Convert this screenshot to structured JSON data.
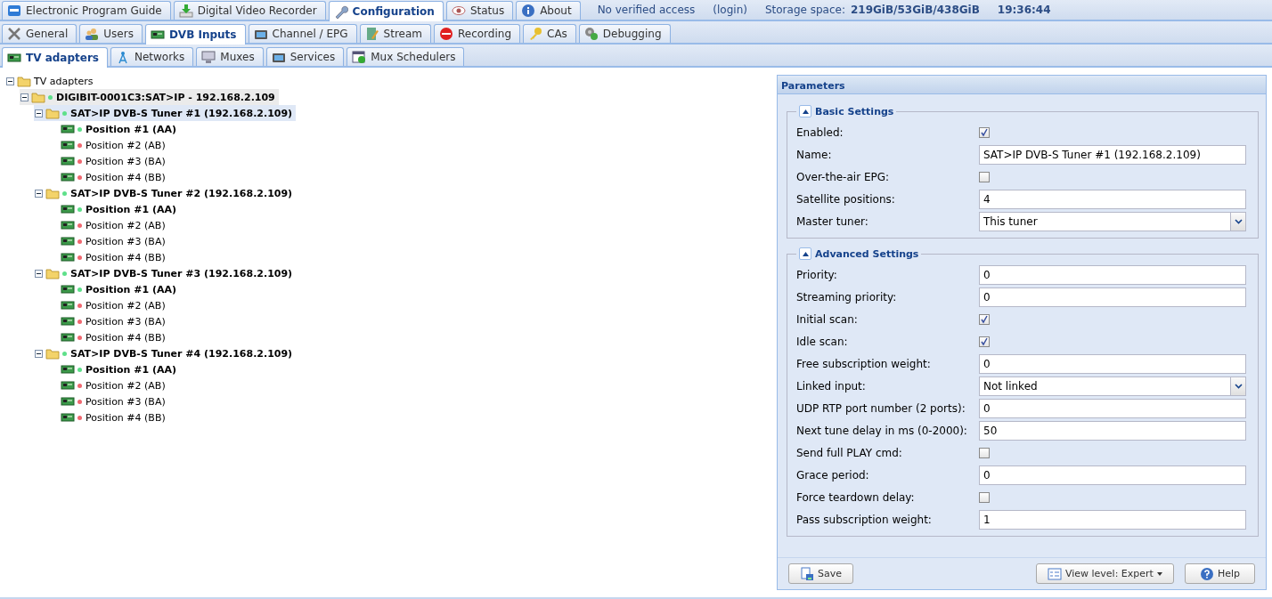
{
  "top_tabs": [
    {
      "label": "Electronic Program Guide",
      "selected": false
    },
    {
      "label": "Digital Video Recorder",
      "selected": false
    },
    {
      "label": "Configuration",
      "selected": true
    },
    {
      "label": "Status",
      "selected": false
    },
    {
      "label": "About",
      "selected": false
    }
  ],
  "status": {
    "access": "No verified access",
    "login": "(login)",
    "storage_label": "Storage space:",
    "storage_value": "219GiB/53GiB/438GiB",
    "time": "19:36:44"
  },
  "config_tabs": [
    {
      "label": "General",
      "selected": false
    },
    {
      "label": "Users",
      "selected": false
    },
    {
      "label": "DVB Inputs",
      "selected": true
    },
    {
      "label": "Channel / EPG",
      "selected": false
    },
    {
      "label": "Stream",
      "selected": false
    },
    {
      "label": "Recording",
      "selected": false
    },
    {
      "label": "CAs",
      "selected": false
    },
    {
      "label": "Debugging",
      "selected": false
    }
  ],
  "dvb_tabs": [
    {
      "label": "TV adapters",
      "selected": true
    },
    {
      "label": "Networks",
      "selected": false
    },
    {
      "label": "Muxes",
      "selected": false
    },
    {
      "label": "Services",
      "selected": false
    },
    {
      "label": "Mux Schedulers",
      "selected": false
    }
  ],
  "tree": {
    "label": "TV adapters",
    "expanded": true,
    "children": [
      {
        "label": "DIGIBIT-0001C3:SAT>IP - 192.168.2.109",
        "kind": "folder",
        "color": "#5ee08a",
        "enabled": true,
        "selected": false,
        "hovered": true,
        "expanded": true,
        "children": [
          {
            "label": "SAT>IP DVB-S Tuner #1 (192.168.2.109)",
            "kind": "folder",
            "color": "#5ee08a",
            "enabled": true,
            "selected": true,
            "hovered": false,
            "expanded": true,
            "children": [
              {
                "label": "Position #1 (AA)",
                "kind": "card",
                "color": "#5ee08a",
                "enabled": true,
                "selected": false,
                "hovered": false
              },
              {
                "label": "Position #2 (AB)",
                "kind": "card",
                "color": "#f06870",
                "enabled": false,
                "selected": false,
                "hovered": false
              },
              {
                "label": "Position #3 (BA)",
                "kind": "card",
                "color": "#f06870",
                "enabled": false,
                "selected": false,
                "hovered": false
              },
              {
                "label": "Position #4 (BB)",
                "kind": "card",
                "color": "#f06870",
                "enabled": false,
                "selected": false,
                "hovered": false
              }
            ]
          },
          {
            "label": "SAT>IP DVB-S Tuner #2 (192.168.2.109)",
            "kind": "folder",
            "color": "#5ee08a",
            "enabled": true,
            "selected": false,
            "hovered": false,
            "expanded": true,
            "children": [
              {
                "label": "Position #1 (AA)",
                "kind": "card",
                "color": "#5ee08a",
                "enabled": true,
                "selected": false,
                "hovered": false
              },
              {
                "label": "Position #2 (AB)",
                "kind": "card",
                "color": "#f06870",
                "enabled": false,
                "selected": false,
                "hovered": false
              },
              {
                "label": "Position #3 (BA)",
                "kind": "card",
                "color": "#f06870",
                "enabled": false,
                "selected": false,
                "hovered": false
              },
              {
                "label": "Position #4 (BB)",
                "kind": "card",
                "color": "#f06870",
                "enabled": false,
                "selected": false,
                "hovered": false
              }
            ]
          },
          {
            "label": "SAT>IP DVB-S Tuner #3 (192.168.2.109)",
            "kind": "folder",
            "color": "#5ee08a",
            "enabled": true,
            "selected": false,
            "hovered": false,
            "expanded": true,
            "children": [
              {
                "label": "Position #1 (AA)",
                "kind": "card",
                "color": "#5ee08a",
                "enabled": true,
                "selected": false,
                "hovered": false
              },
              {
                "label": "Position #2 (AB)",
                "kind": "card",
                "color": "#f06870",
                "enabled": false,
                "selected": false,
                "hovered": false
              },
              {
                "label": "Position #3 (BA)",
                "kind": "card",
                "color": "#f06870",
                "enabled": false,
                "selected": false,
                "hovered": false
              },
              {
                "label": "Position #4 (BB)",
                "kind": "card",
                "color": "#f06870",
                "enabled": false,
                "selected": false,
                "hovered": false
              }
            ]
          },
          {
            "label": "SAT>IP DVB-S Tuner #4 (192.168.2.109)",
            "kind": "folder",
            "color": "#5ee08a",
            "enabled": true,
            "selected": false,
            "hovered": false,
            "expanded": true,
            "children": [
              {
                "label": "Position #1 (AA)",
                "kind": "card",
                "color": "#5ee08a",
                "enabled": true,
                "selected": false,
                "hovered": false
              },
              {
                "label": "Position #2 (AB)",
                "kind": "card",
                "color": "#f06870",
                "enabled": false,
                "selected": false,
                "hovered": false
              },
              {
                "label": "Position #3 (BA)",
                "kind": "card",
                "color": "#f06870",
                "enabled": false,
                "selected": false,
                "hovered": false
              },
              {
                "label": "Position #4 (BB)",
                "kind": "card",
                "color": "#f06870",
                "enabled": false,
                "selected": false,
                "hovered": false
              }
            ]
          }
        ]
      }
    ]
  },
  "params": {
    "title": "Parameters",
    "sections": [
      {
        "title": "Basic Settings",
        "expanded": true,
        "fields": [
          {
            "kind": "checkbox",
            "label": "Enabled:",
            "checked": true
          },
          {
            "kind": "text",
            "label": "Name:",
            "value": "SAT>IP DVB-S Tuner #1 (192.168.2.109)"
          },
          {
            "kind": "checkbox",
            "label": "Over-the-air EPG:",
            "checked": false
          },
          {
            "kind": "text",
            "label": "Satellite positions:",
            "value": "4"
          },
          {
            "kind": "select",
            "label": "Master tuner:",
            "value": "This tuner"
          }
        ]
      },
      {
        "title": "Advanced Settings",
        "expanded": true,
        "fields": [
          {
            "kind": "text",
            "label": "Priority:",
            "value": "0"
          },
          {
            "kind": "text",
            "label": "Streaming priority:",
            "value": "0"
          },
          {
            "kind": "checkbox",
            "label": "Initial scan:",
            "checked": true
          },
          {
            "kind": "checkbox",
            "label": "Idle scan:",
            "checked": true
          },
          {
            "kind": "text",
            "label": "Free subscription weight:",
            "value": "0"
          },
          {
            "kind": "select",
            "label": "Linked input:",
            "value": "Not linked"
          },
          {
            "kind": "text",
            "label": "UDP RTP port number (2 ports):",
            "value": "0"
          },
          {
            "kind": "text",
            "label": "Next tune delay in ms (0-2000):",
            "value": "50"
          },
          {
            "kind": "checkbox",
            "label": "Send full PLAY cmd:",
            "checked": false
          },
          {
            "kind": "text",
            "label": "Grace period:",
            "value": "0"
          },
          {
            "kind": "checkbox",
            "label": "Force teardown delay:",
            "checked": false
          },
          {
            "kind": "text",
            "label": "Pass subscription weight:",
            "value": "1"
          }
        ]
      }
    ],
    "buttons": {
      "save": "Save",
      "view_level": "View level: Expert",
      "help": "Help"
    }
  }
}
